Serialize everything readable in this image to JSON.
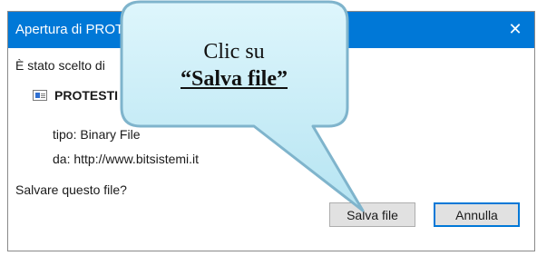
{
  "colors": {
    "accent": "#0078d7",
    "callout_fill": "#c4ecf7",
    "callout_border": "#7fb4cc"
  },
  "dialog": {
    "title": "Apertura di PROT",
    "close_icon": "✕",
    "message": "È stato scelto di",
    "file_name": "PROTESTI",
    "type_text": "tipo: Binary File",
    "source_text": "da: http://www.bitsistemi.it",
    "question": "Salvare questo file?",
    "save_button": "Salva file",
    "cancel_button": "Annulla"
  },
  "callout": {
    "line1": "Clic su",
    "line2": "“Salva file”"
  }
}
